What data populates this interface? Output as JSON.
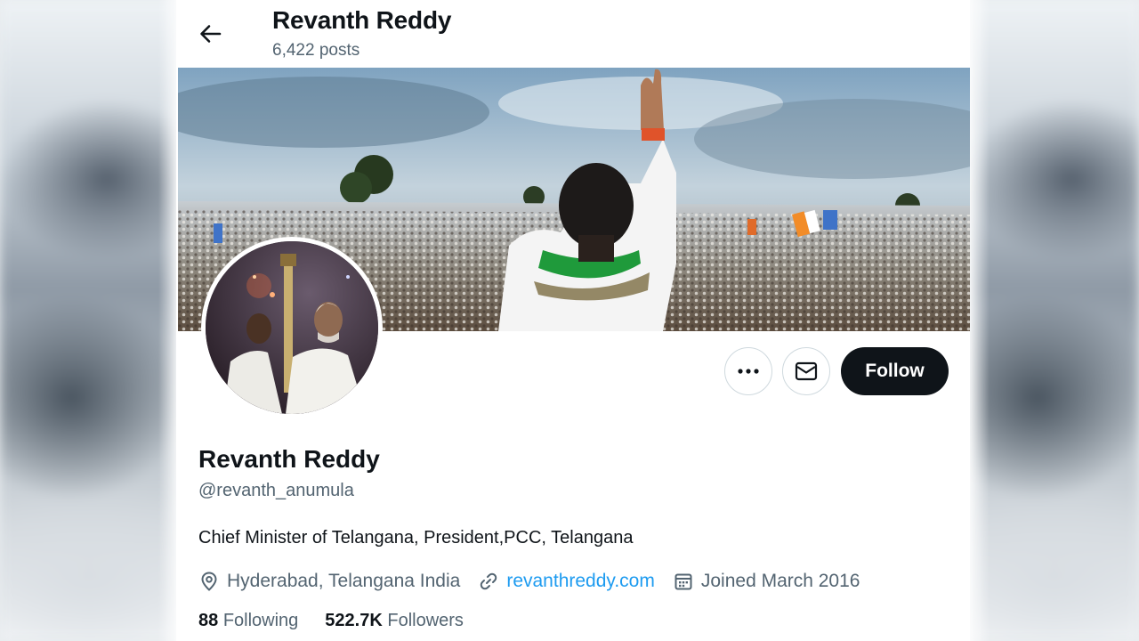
{
  "header": {
    "title": "Revanth Reddy",
    "posts_count": "6,422 posts"
  },
  "banner": {
    "description_icon": "rally-crowd-photo"
  },
  "profile": {
    "name": "Revanth Reddy",
    "handle": "@revanth_anumula",
    "bio": "Chief Minister of Telangana, President,PCC, Telangana",
    "location": "Hyderabad, Telangana India",
    "website": "revanthreddy.com",
    "joined": "Joined March 2016",
    "following_count": "88",
    "following_label": "Following",
    "followers_count": "522.7K",
    "followers_label": "Followers"
  },
  "actions": {
    "more_icon": "more-icon",
    "message_icon": "mail-icon",
    "follow_label": "Follow"
  },
  "colors": {
    "link": "#1d9bf0",
    "secondary_text": "#536471",
    "follow_bg": "#0f1419"
  }
}
